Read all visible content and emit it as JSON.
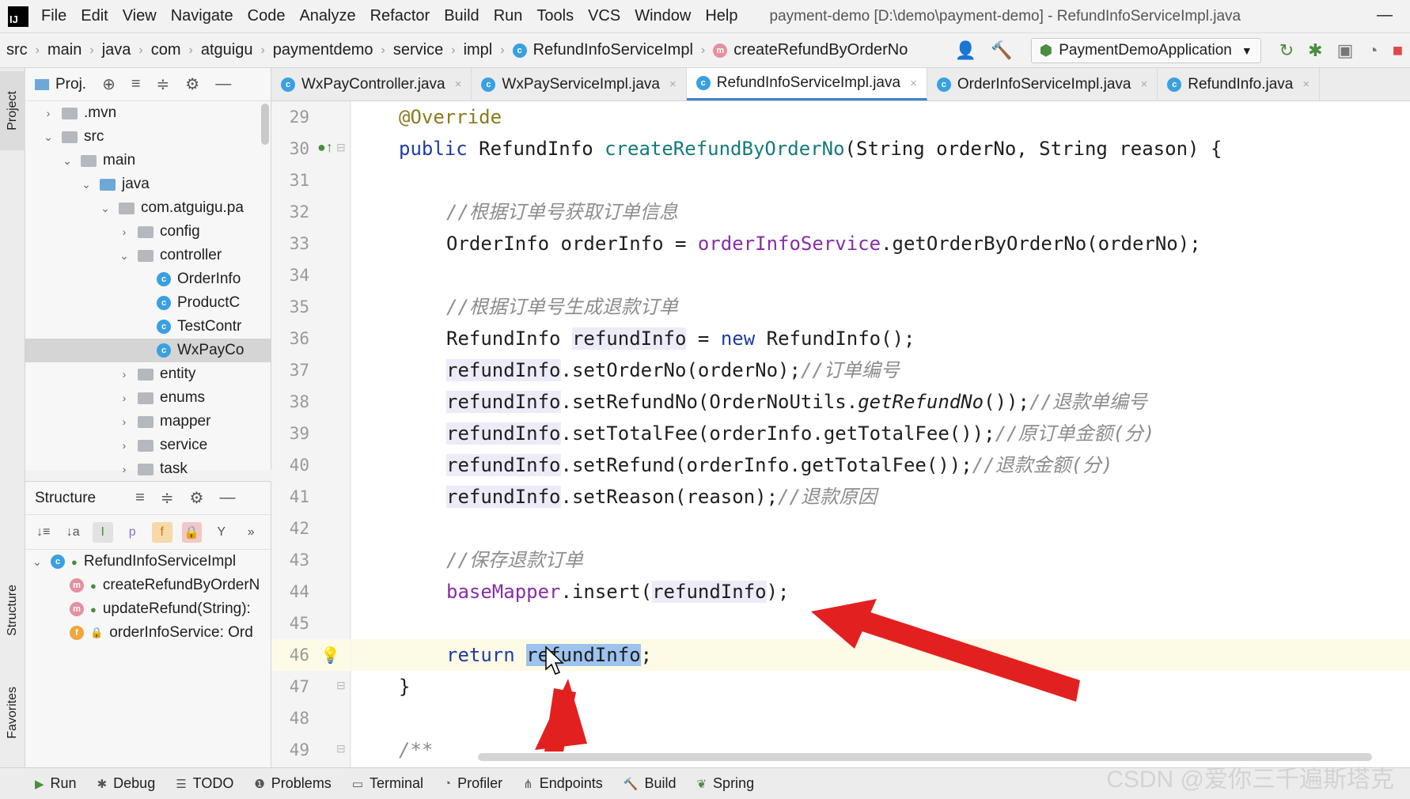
{
  "menubar": {
    "logo": "IJ",
    "items": [
      "File",
      "Edit",
      "View",
      "Navigate",
      "Code",
      "Analyze",
      "Refactor",
      "Build",
      "Run",
      "Tools",
      "VCS",
      "Window",
      "Help"
    ],
    "window_title": "payment-demo [D:\\demo\\payment-demo] - RefundInfoServiceImpl.java"
  },
  "navbar": {
    "crumbs": [
      "src",
      "main",
      "java",
      "com",
      "atguigu",
      "paymentdemo",
      "service",
      "impl",
      "RefundInfoServiceImpl",
      "createRefundByOrderNo"
    ],
    "run_config": "PaymentDemoApplication"
  },
  "left_strip": {
    "project": "Project",
    "structure": "Structure",
    "favorites": "Favorites"
  },
  "project": {
    "title": "Proj.",
    "tree": [
      {
        "label": ".mvn",
        "arrow": "›",
        "type": "folder"
      },
      {
        "label": "src",
        "arrow": "⌄",
        "type": "folder"
      },
      {
        "label": "main",
        "arrow": "⌄",
        "type": "folder"
      },
      {
        "label": "java",
        "arrow": "⌄",
        "type": "folder-blue"
      },
      {
        "label": "com.atguigu.pa",
        "arrow": "⌄",
        "type": "folder"
      },
      {
        "label": "config",
        "arrow": "›",
        "type": "folder"
      },
      {
        "label": "controller",
        "arrow": "⌄",
        "type": "folder"
      },
      {
        "label": "OrderInfo",
        "arrow": "",
        "type": "class"
      },
      {
        "label": "ProductC",
        "arrow": "",
        "type": "class"
      },
      {
        "label": "TestContr",
        "arrow": "",
        "type": "class"
      },
      {
        "label": "WxPayCo",
        "arrow": "",
        "type": "class"
      },
      {
        "label": "entity",
        "arrow": "›",
        "type": "folder"
      },
      {
        "label": "enums",
        "arrow": "›",
        "type": "folder"
      },
      {
        "label": "mapper",
        "arrow": "›",
        "type": "folder"
      },
      {
        "label": "service",
        "arrow": "›",
        "type": "folder"
      },
      {
        "label": "task",
        "arrow": "›",
        "type": "folder"
      }
    ]
  },
  "structure": {
    "title": "Structure",
    "items": [
      {
        "label": "RefundInfoServiceImpl",
        "icon": "C"
      },
      {
        "label": "createRefundByOrderN",
        "icon": "m"
      },
      {
        "label": "updateRefund(String):",
        "icon": "m"
      },
      {
        "label": "orderInfoService: Ord",
        "icon": "f"
      }
    ]
  },
  "tabs": [
    "WxPayController.java",
    "WxPayServiceImpl.java",
    "RefundInfoServiceImpl.java",
    "OrderInfoServiceImpl.java",
    "RefundInfo.java"
  ],
  "code": {
    "line_numbers": [
      "29",
      "30",
      "31",
      "32",
      "33",
      "34",
      "35",
      "36",
      "37",
      "38",
      "39",
      "40",
      "41",
      "42",
      "43",
      "44",
      "45",
      "46",
      "47",
      "48",
      "49"
    ],
    "l29": "@Override",
    "l30_kw": "public ",
    "l30_type": "RefundInfo ",
    "l30_fn": "createRefundByOrderNo",
    "l30_rest": "(String orderNo, String reason) {",
    "l32": "//根据订单号获取订单信息",
    "l33_a": "OrderInfo orderInfo = ",
    "l33_fld": "orderInfoService",
    "l33_b": ".getOrderByOrderNo(orderNo);",
    "l35": "//根据订单号生成退款订单",
    "l36_a": "RefundInfo ",
    "l36_var": "refundInfo",
    "l36_b": " = ",
    "l36_kw": "new",
    "l36_c": " RefundInfo();",
    "l37_a": "refundInfo",
    "l37_b": ".setOrderNo(orderNo);",
    "l37_c": "//订单编号",
    "l38_a": "refundInfo",
    "l38_b": ".setRefundNo(OrderNoUtils.",
    "l38_i": "getRefundNo",
    "l38_c": "());",
    "l38_cm": "//退款单编号",
    "l39_a": "refundInfo",
    "l39_b": ".setTotalFee(orderInfo.getTotalFee());",
    "l39_c": "//原订单金额(分)",
    "l40_a": "refundInfo",
    "l40_b": ".setRefund(orderInfo.getTotalFee());",
    "l40_c": "//退款金额(分)",
    "l41_a": "refundInfo",
    "l41_b": ".setReason(reason);",
    "l41_c": "//退款原因",
    "l43": "//保存退款订单",
    "l44_fld": "baseMapper",
    "l44_a": ".insert(",
    "l44_var": "refundInfo",
    "l44_b": ");",
    "l46_kw": "return ",
    "l46_sel": "refundInfo",
    "l46_b": ";",
    "l47": "}",
    "l49": "/**"
  },
  "bottom_tools": [
    "Run",
    "Debug",
    "TODO",
    "Problems",
    "Terminal",
    "Profiler",
    "Endpoints",
    "Build",
    "Spring"
  ],
  "watermark": "CSDN @爱你三千遍斯塔克",
  "colors": {
    "arrow": "#e32020",
    "selection": "#9ec3ef",
    "accent": "#4083c9"
  }
}
